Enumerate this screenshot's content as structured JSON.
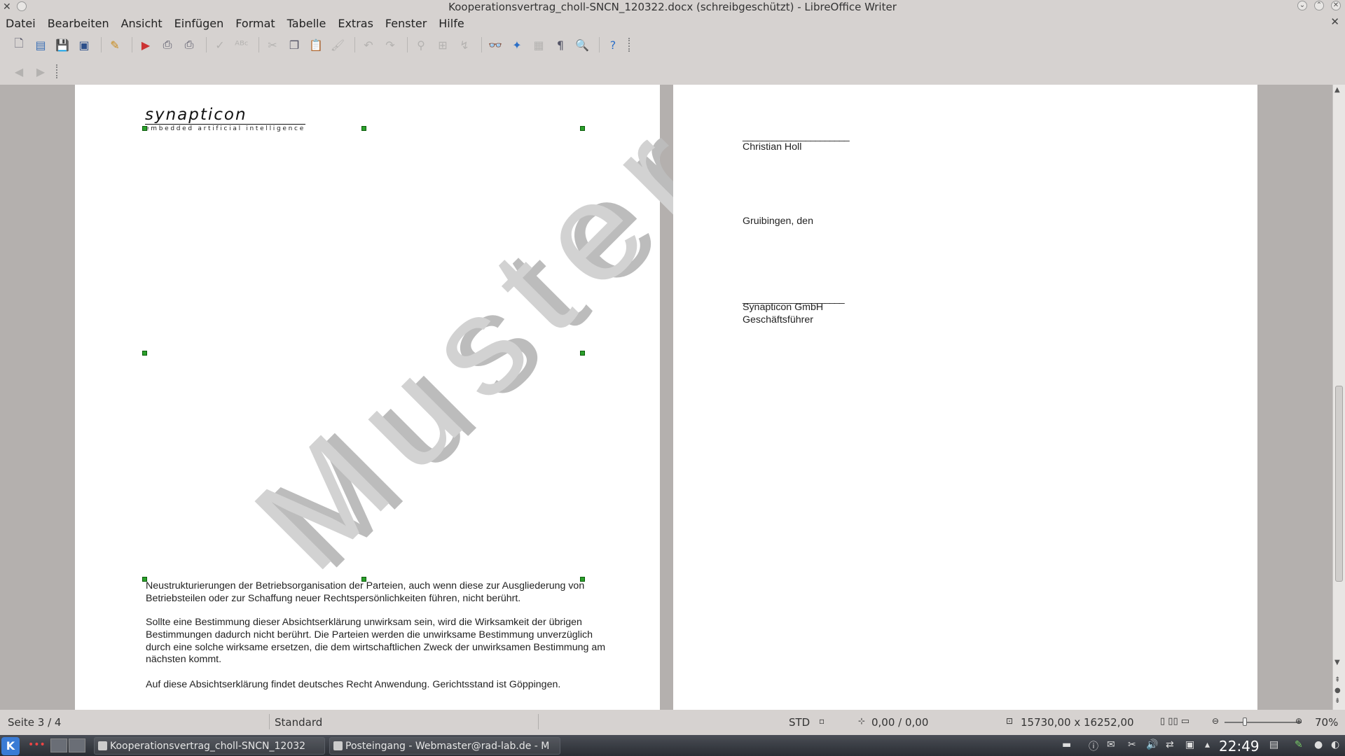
{
  "window": {
    "title": "Kooperationsvertrag_choll-SNCN_120322.docx (schreibgeschützt) - LibreOffice Writer"
  },
  "menubar": {
    "items": [
      "Datei",
      "Bearbeiten",
      "Ansicht",
      "Einfügen",
      "Format",
      "Tabelle",
      "Extras",
      "Fenster",
      "Hilfe"
    ]
  },
  "toolbar": {
    "icons": [
      "new-document-icon",
      "open-icon",
      "save-icon",
      "save-as-pdf-icon",
      "edit-document-icon",
      "export-pdf-icon",
      "print-icon",
      "print-preview-icon",
      "spellcheck-icon",
      "autospellcheck-icon",
      "cut-icon",
      "copy-icon",
      "paste-icon",
      "clone-format-icon",
      "undo-icon",
      "redo-icon",
      "hyperlink-icon",
      "table-icon",
      "draw-icon",
      "find-replace-icon",
      "navigator-icon",
      "gallery-icon",
      "formatting-marks-icon",
      "zoom-icon",
      "help-icon"
    ]
  },
  "page1": {
    "logo_word": "synapticon",
    "logo_tagline": "embedded artificial intelligence",
    "watermark": "Muster",
    "paragraph1": "Neustrukturierungen der Betriebsorganisation der Parteien, auch wenn diese zur Ausgliederung von Betriebsteilen oder zur Schaffung neuer Rechtspersönlichkeiten führen, nicht berührt.",
    "paragraph2": "Sollte eine Bestimmung dieser Absichtserklärung unwirksam sein, wird die Wirksamkeit der übrigen Bestimmungen dadurch nicht berührt. Die Parteien werden die unwirksame Bestimmung unverzüglich durch eine solche wirksame ersetzen, die dem wirtschaftlichen Zweck der unwirksamen Bestimmung am nächsten kommt.",
    "paragraph3": "Auf diese Absichtserklärung findet deutsches Recht Anwendung. Gerichtsstand ist Göppingen."
  },
  "page2": {
    "signature_line1": "______________________",
    "name1": "Christian Holl",
    "place_date": "Gruibingen, den",
    "signature_line2": "_____________________",
    "company": "Synapticon GmbH",
    "role": "Geschäftsführer"
  },
  "statusbar": {
    "page": "Seite 3 / 4",
    "style": "Standard",
    "mode": "STD",
    "position": "0,00 / 0,00",
    "size": "15730,00 x 16252,00",
    "zoom": "70%"
  },
  "taskbar": {
    "task1": "Kooperationsvertrag_choll-SNCN_12032",
    "task2": "Posteingang - Webmaster@rad-lab.de - M",
    "clock": "22:49"
  }
}
